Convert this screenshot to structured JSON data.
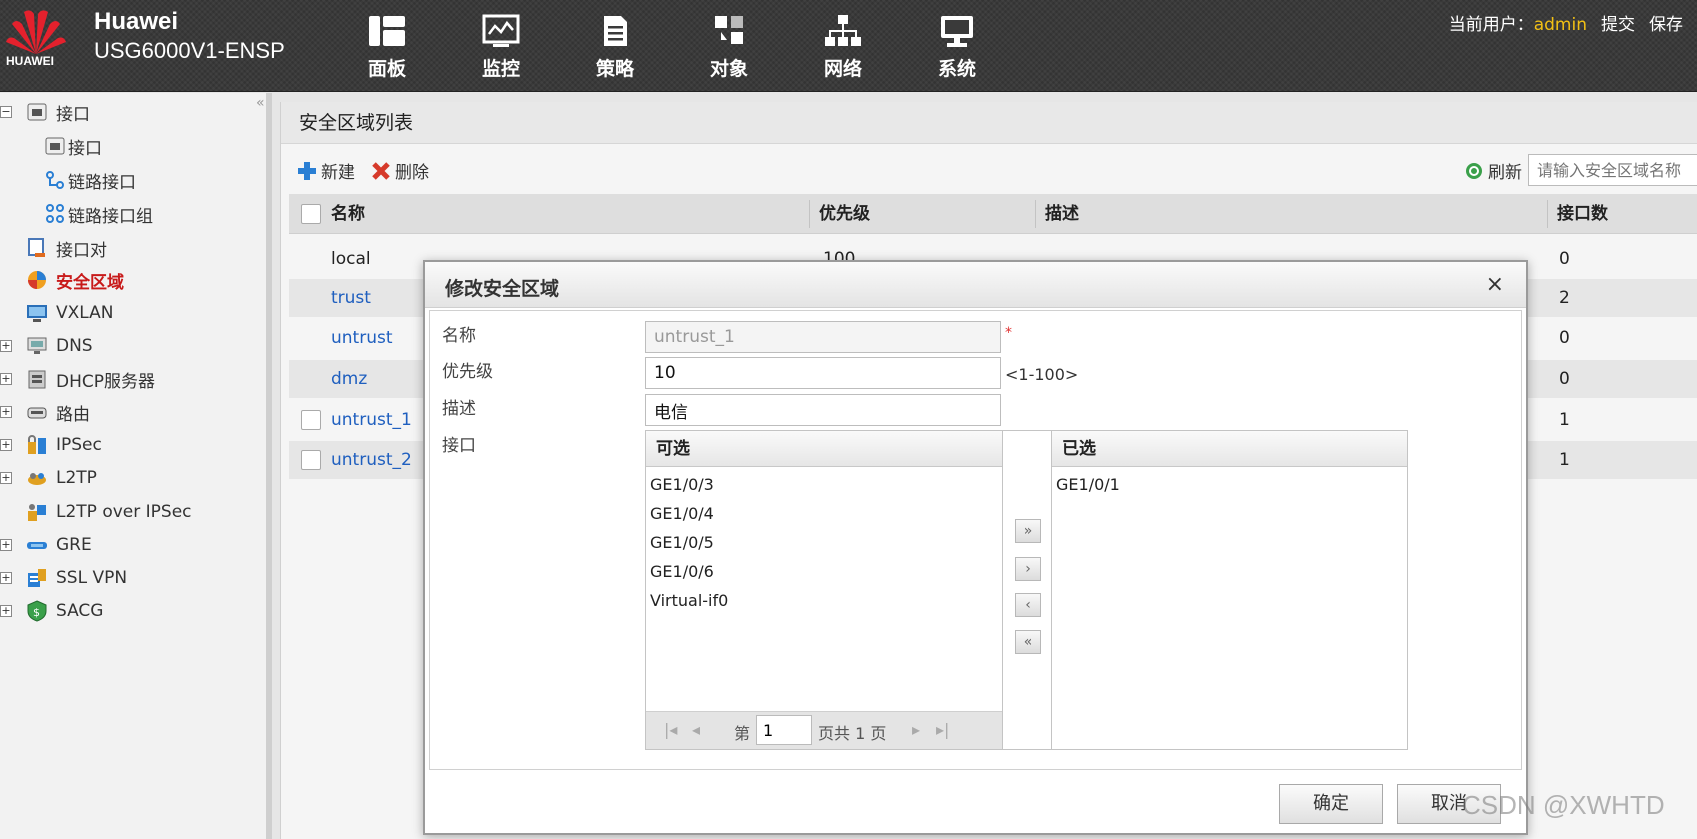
{
  "brand": {
    "logo_text": "HUAWEI",
    "name": "Huawei",
    "model": "USG6000V1-ENSP"
  },
  "nav": [
    {
      "label": "面板",
      "icon": "dashboard-icon"
    },
    {
      "label": "监控",
      "icon": "monitor-icon"
    },
    {
      "label": "策略",
      "icon": "policy-icon"
    },
    {
      "label": "对象",
      "icon": "object-icon"
    },
    {
      "label": "网络",
      "icon": "network-icon"
    },
    {
      "label": "系统",
      "icon": "system-icon"
    }
  ],
  "user": {
    "prefix": "当前用户：",
    "name": "admin",
    "submit": "提交",
    "save": "保存"
  },
  "sidebar": {
    "collapse": "«",
    "items": [
      {
        "label": "接口",
        "icon": "interface-icon",
        "expander": "−"
      },
      {
        "label": "接口",
        "icon": "interface-icon"
      },
      {
        "label": "链路接口",
        "icon": "link-interface-icon"
      },
      {
        "label": "链路接口组",
        "icon": "link-group-icon"
      },
      {
        "label": "接口对",
        "icon": "interface-pair-icon"
      },
      {
        "label": "安全区域",
        "icon": "security-zone-icon"
      },
      {
        "label": "VXLAN",
        "icon": "vxlan-icon"
      },
      {
        "label": "DNS",
        "icon": "dns-icon",
        "expander": "+"
      },
      {
        "label": "DHCP服务器",
        "icon": "dhcp-icon",
        "expander": "+"
      },
      {
        "label": "路由",
        "icon": "route-icon",
        "expander": "+"
      },
      {
        "label": "IPSec",
        "icon": "ipsec-icon",
        "expander": "+"
      },
      {
        "label": "L2TP",
        "icon": "l2tp-icon",
        "expander": "+"
      },
      {
        "label": "L2TP over IPSec",
        "icon": "l2tp-ipsec-icon"
      },
      {
        "label": "GRE",
        "icon": "gre-icon",
        "expander": "+"
      },
      {
        "label": "SSL VPN",
        "icon": "ssl-vpn-icon",
        "expander": "+"
      },
      {
        "label": "SACG",
        "icon": "sacg-icon",
        "expander": "+"
      }
    ]
  },
  "main": {
    "title": "安全区域列表",
    "toolbar": {
      "new": "新建",
      "delete": "删除",
      "refresh": "刷新",
      "search_placeholder": "请输入安全区域名称"
    },
    "columns": {
      "name": "名称",
      "priority": "优先级",
      "description": "描述",
      "interfaces": "接口数"
    },
    "rows": [
      {
        "name": "local",
        "priority": "100",
        "count": "0"
      },
      {
        "name": "trust",
        "count": "2"
      },
      {
        "name": "untrust",
        "count": "0"
      },
      {
        "name": "dmz",
        "count": "0"
      },
      {
        "name": "untrust_1",
        "count": "1"
      },
      {
        "name": "untrust_2",
        "count": "1"
      }
    ]
  },
  "dialog": {
    "title": "修改安全区域",
    "close": "×",
    "name_label": "名称",
    "name_value": "untrust_1",
    "required_mark": "*",
    "priority_label": "优先级",
    "priority_value": "10",
    "priority_range": "<1-100>",
    "desc_label": "描述",
    "desc_value": "电信",
    "interface_label": "接口",
    "available_title": "可选",
    "available": [
      "GE1/0/3",
      "GE1/0/4",
      "GE1/0/5",
      "GE1/0/6",
      "Virtual-if0"
    ],
    "selected_title": "已选",
    "selected": [
      "GE1/0/1"
    ],
    "pager": {
      "first": "|◂",
      "prev": "◂",
      "page_prefix": "第",
      "page_value": "1",
      "page_total": "页共 1 页",
      "next": "▸",
      "last": "▸|"
    },
    "move_buttons": [
      "»",
      "›",
      "‹",
      "«"
    ],
    "ok": "确定",
    "cancel": "取消"
  },
  "watermark": "CSDN @XWHTD",
  "colors": {
    "accent_red": "#c81a1a",
    "link_blue": "#1f5fbf",
    "admin_yellow": "#f2c014"
  }
}
